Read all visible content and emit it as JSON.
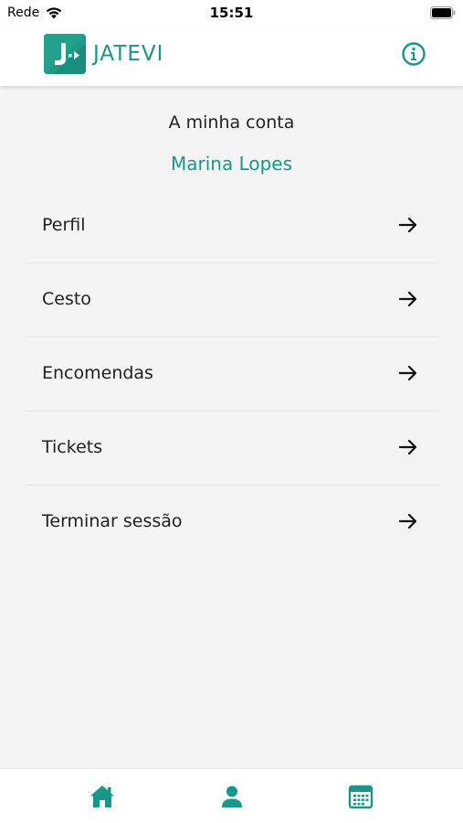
{
  "status_bar": {
    "carrier": "Rede",
    "time": "15:51"
  },
  "header": {
    "logo_letter": "J",
    "app_name": "JATEVI",
    "info_icon": "info-icon"
  },
  "account": {
    "title": "A minha conta",
    "user_name": "Marina Lopes"
  },
  "menu": {
    "items": [
      {
        "label": "Perfil",
        "icon": "arrow-right-icon"
      },
      {
        "label": "Cesto",
        "icon": "arrow-right-icon"
      },
      {
        "label": "Encomendas",
        "icon": "arrow-right-icon"
      },
      {
        "label": "Tickets",
        "icon": "arrow-right-icon"
      },
      {
        "label": "Terminar sessão",
        "icon": "arrow-right-icon"
      }
    ]
  },
  "bottom_nav": {
    "items": [
      {
        "icon": "home-icon"
      },
      {
        "icon": "user-icon"
      },
      {
        "icon": "calendar-icon"
      }
    ]
  },
  "colors": {
    "accent": "#17968a",
    "background": "#f4f4f4",
    "header_background": "#ffffff"
  }
}
